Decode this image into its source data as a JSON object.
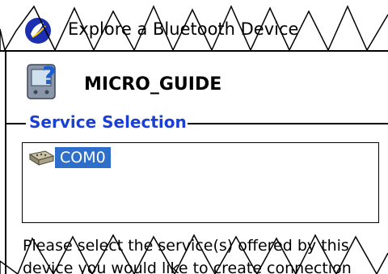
{
  "title_bar": {
    "title": "Explore a Bluetooth Device",
    "start_icon": "windows-flag-icon"
  },
  "device": {
    "name": "MICRO_GUIDE",
    "icon": "pda-question-icon"
  },
  "service_selection": {
    "label": "Service Selection",
    "items": [
      {
        "label": "COM0",
        "icon": "serial-port-icon",
        "selected": true
      }
    ]
  },
  "description": {
    "line1": "Please select the service(s) offered by this",
    "line2": "device you would like to create connection"
  },
  "colors": {
    "group_label": "#1a3fd6",
    "selection": "#2f6fcc"
  }
}
